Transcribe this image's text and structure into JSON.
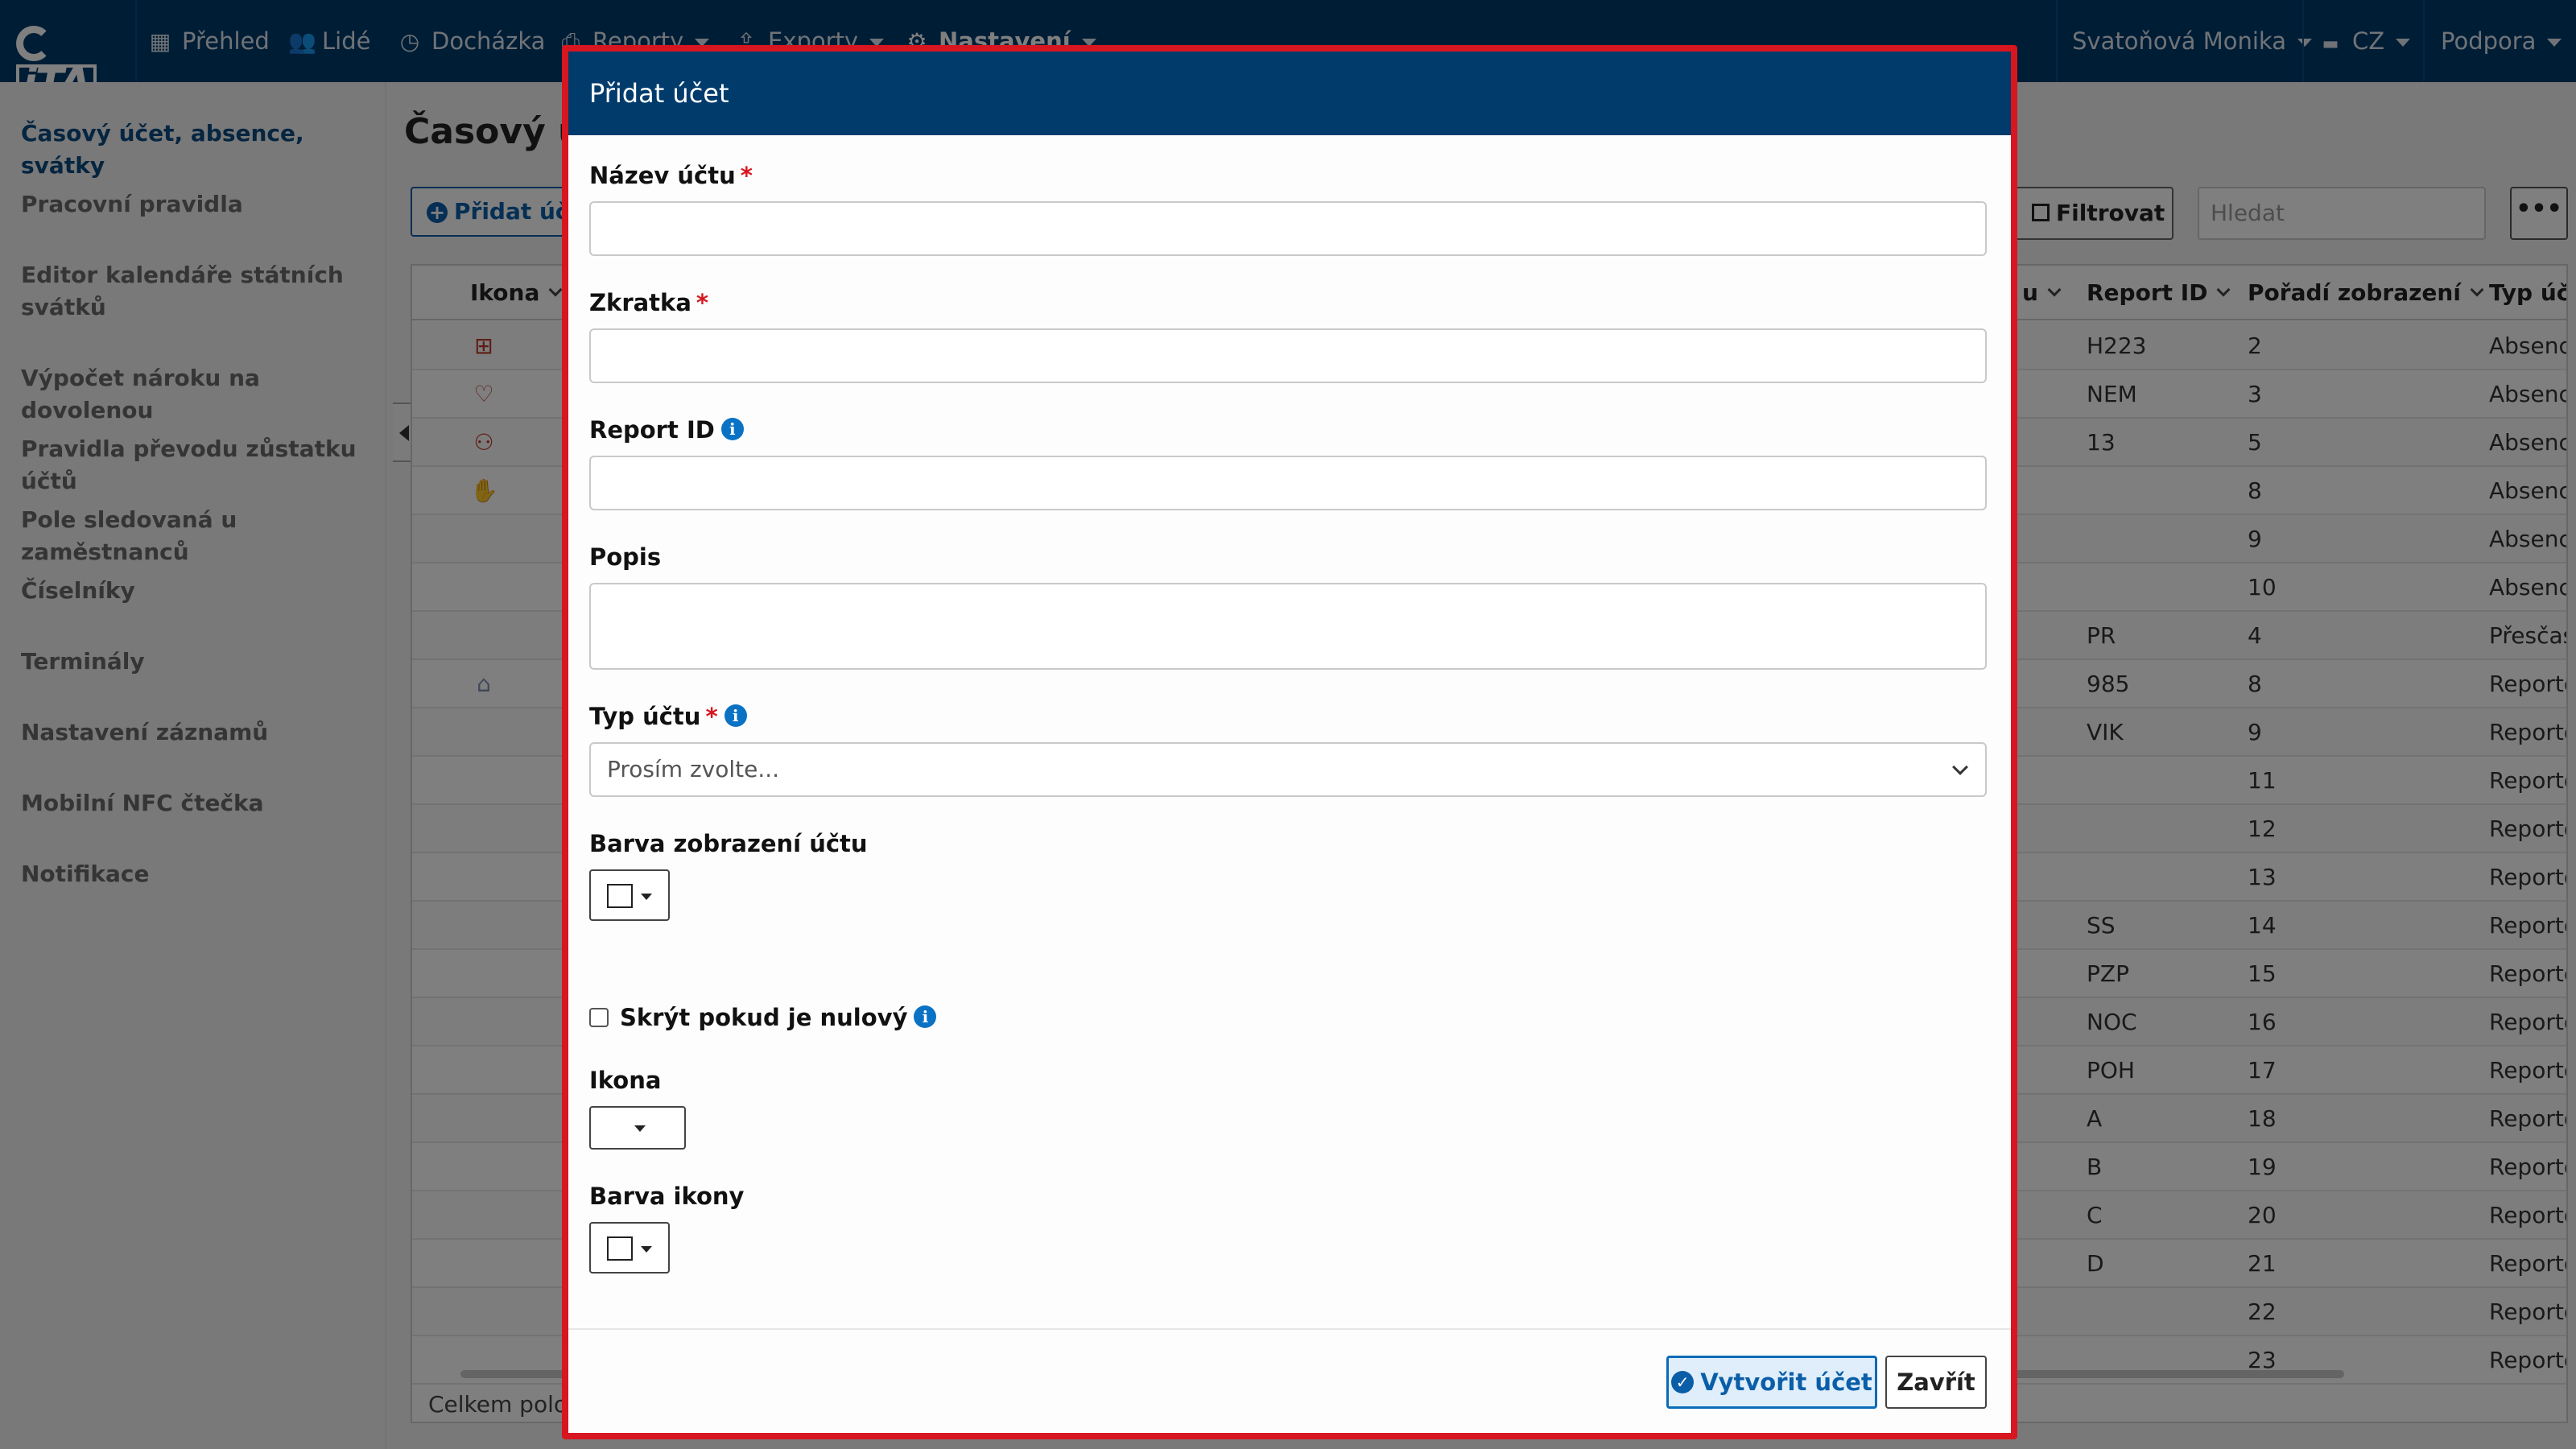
{
  "nav": {
    "logo_text": "iTA",
    "items": [
      {
        "label": "Přehled",
        "icon": "grid-icon"
      },
      {
        "label": "Lidé",
        "icon": "users-icon"
      },
      {
        "label": "Docházka",
        "icon": "clock-icon"
      },
      {
        "label": "Reporty",
        "icon": "printer-icon"
      },
      {
        "label": "Exporty",
        "icon": "export-icon"
      },
      {
        "label": "Nastavení",
        "icon": "gear-icon"
      }
    ],
    "user": "Svatoňová Monika",
    "language": "CZ",
    "support": "Podpora"
  },
  "sidebar": {
    "items": [
      {
        "label": "Časový účet, absence, svátky",
        "active": true
      },
      {
        "label": "Pracovní pravidla"
      },
      {
        "label": "Editor kalendáře státních svátků"
      },
      {
        "label": "Výpočet nároku na dovolenou"
      },
      {
        "label": "Pravidla převodu zůstatku účtů"
      },
      {
        "label": "Pole sledovaná u zaměstnanců"
      },
      {
        "label": "Číselníky"
      },
      {
        "label": "Terminály"
      },
      {
        "label": "Nastavení záznamů"
      },
      {
        "label": "Mobilní NFC čtečka"
      },
      {
        "label": "Notifikace"
      }
    ]
  },
  "main": {
    "title": "Časový úč",
    "add_button": "Přidat úč",
    "filter_button": "Filtrovat",
    "search_placeholder": "Hledat",
    "more_button": "•••",
    "total_label": "Celkem polo",
    "columns": {
      "icon": "Ikona",
      "partial": "u",
      "report_id": "Report ID",
      "order": "Pořadí zobrazení",
      "type": "Typ účt"
    },
    "rows": [
      {
        "report_id": "H223",
        "order": "2",
        "type": "Absenc",
        "icon": "medical-icon"
      },
      {
        "report_id": "NEM",
        "order": "3",
        "type": "Absenc",
        "icon": "heart-icon"
      },
      {
        "report_id": "13",
        "order": "5",
        "type": "Absenc",
        "icon": "people-icon"
      },
      {
        "report_id": "",
        "order": "8",
        "type": "Absenc",
        "icon": "hand-icon"
      },
      {
        "report_id": "",
        "order": "9",
        "type": "Absenc"
      },
      {
        "report_id": "",
        "order": "10",
        "type": "Absenc"
      },
      {
        "report_id": "PR",
        "order": "4",
        "type": "Přesčas"
      },
      {
        "report_id": "985",
        "order": "8",
        "type": "Reporto",
        "icon": "home-icon"
      },
      {
        "report_id": "VIK",
        "order": "9",
        "type": "Reporto"
      },
      {
        "report_id": "",
        "order": "11",
        "type": "Reporto"
      },
      {
        "report_id": "",
        "order": "12",
        "type": "Reporto"
      },
      {
        "report_id": "",
        "order": "13",
        "type": "Reporto"
      },
      {
        "report_id": "SS",
        "order": "14",
        "type": "Reporto"
      },
      {
        "report_id": "PZP",
        "order": "15",
        "type": "Reporto"
      },
      {
        "report_id": "NOC",
        "order": "16",
        "type": "Reporto"
      },
      {
        "report_id": "POH",
        "order": "17",
        "type": "Reporto"
      },
      {
        "report_id": "A",
        "order": "18",
        "type": "Reporto"
      },
      {
        "report_id": "B",
        "order": "19",
        "type": "Reporto"
      },
      {
        "report_id": "C",
        "order": "20",
        "type": "Reporto"
      },
      {
        "report_id": "D",
        "order": "21",
        "type": "Reporto"
      },
      {
        "report_id": "",
        "order": "22",
        "type": "Reporto"
      },
      {
        "report_id": "",
        "order": "23",
        "type": "Reporto"
      }
    ]
  },
  "modal": {
    "title": "Přidat účet",
    "fields": {
      "account_name": {
        "label": "Název účtu",
        "value": ""
      },
      "abbreviation": {
        "label": "Zkratka",
        "value": ""
      },
      "report_id": {
        "label": "Report ID",
        "value": ""
      },
      "description": {
        "label": "Popis",
        "value": ""
      },
      "account_type": {
        "label": "Typ účtu",
        "selected": "Prosím zvolte..."
      },
      "display_color": {
        "label": "Barva zobrazení účtu"
      },
      "hide_if_zero": {
        "label": "Skrýt pokud je nulový",
        "checked": false
      },
      "icon": {
        "label": "Ikona"
      },
      "icon_color": {
        "label": "Barva ikony"
      }
    },
    "required_mark": "*",
    "create_button": "Vytvořit účet",
    "close_button": "Zavřít"
  },
  "colors": {
    "nav_bg": "#003b6c",
    "accent": "#0a5ea8",
    "required": "#d7161f",
    "highlight_outline": "#d7161f"
  }
}
